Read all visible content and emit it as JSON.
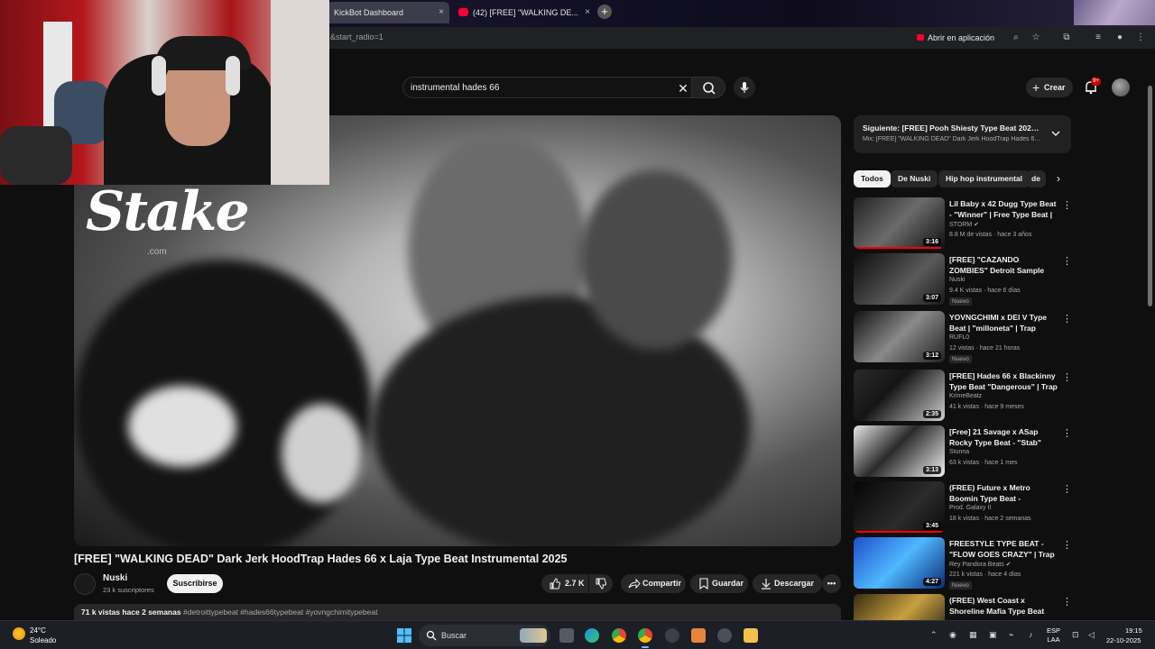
{
  "browser": {
    "tabs": [
      {
        "label": "KickBot Dashboard",
        "close": "×"
      },
      {
        "label": "(42) [FREE] \"WALKING DE...",
        "close": "×"
      }
    ],
    "new_tab": "+",
    "url": "&start_radio=1",
    "open_app_label": "Abrir en aplicación"
  },
  "youtube": {
    "search_value": "instrumental hades 66",
    "search_clear": "✕",
    "create_label": "Crear",
    "notification_badge": "9+"
  },
  "player": {
    "watermark": "Stake",
    "watermark_sub": ".com"
  },
  "video": {
    "title": "[FREE] \"WALKING DEAD\" Dark Jerk HoodTrap Hades 66 x Laja Type Beat Instrumental 2025",
    "channel": "Nuski",
    "subscribers": "23 k suscriptores",
    "subscribe_label": "Suscribirse",
    "likes": "2.7 K",
    "share_label": "Compartir",
    "save_label": "Guardar",
    "download_label": "Descargar",
    "more_label": "•••",
    "description_meta": "71 k vistas  hace 2 semanas",
    "description_tags": "#detroittypebeat #hades66typebeat #yovngchimitypebeat"
  },
  "sidebar": {
    "next_title": "Siguiente: [FREE] Pooh Shiesty Type Beat 2022 - Bl...",
    "next_subtitle": "Mix: [FREE] \"WALKING DEAD\" Dark Jerk HoodTrap Hades 66 ...",
    "chips": [
      "Todos",
      "De Nuski",
      "Hip hop instrumental",
      "de"
    ],
    "recommendations": [
      {
        "title": "Lil Baby x 42 Dugg Type Beat - \"Winner\" | Free Type Beat | ...",
        "channel": "STORM ✔",
        "stats": "8.8 M de vistas · hace 3 años",
        "duration": "3:16",
        "badge": "",
        "progress": 0.96
      },
      {
        "title": "[FREE] \"CAZANDO ZOMBIES\" Detroit Sample Dark Type Beat...",
        "channel": "Nuski",
        "stats": "9.4 K vistas · hace 6 días",
        "duration": "3:07",
        "badge": "Nuevo",
        "progress": 0
      },
      {
        "title": "YOVNGCHIMI x DEI V Type Beat | \"milloneta\" | Trap Instrumental",
        "channel": "RUFL0",
        "stats": "12 vistas · hace 21 horas",
        "duration": "3:12",
        "badge": "Nuevo",
        "progress": 0
      },
      {
        "title": "[FREE] Hades 66 x Blackinny Type Beat \"Dangerous\" | Trap ...",
        "channel": "KrimeBeatz",
        "stats": "41 k vistas · hace 9 meses",
        "duration": "2:35",
        "badge": "",
        "progress": 0
      },
      {
        "title": "[Free] 21 Savage x ASap Rocky Type Beat - \"Stab\"",
        "channel": "Stunna",
        "stats": "63 k vistas · hace 1 mes",
        "duration": "3:13",
        "badge": "",
        "progress": 0
      },
      {
        "title": "(FREE) Future x Metro Boomin Type Beat - \"Brazzier\"",
        "channel": "Prod. Galaxy II",
        "stats": "18 k vistas · hace 2 semanas",
        "duration": "3:45",
        "badge": "",
        "progress": 1.0
      },
      {
        "title": "FREESTYLE TYPE BEAT - \"FLOW GOES CRAZY\" | Trap ...",
        "channel": "Rey Pandora Beats ✔",
        "stats": "221 k vistas · hace 4 días",
        "duration": "4:27",
        "badge": "Nuevo",
        "progress": 0
      },
      {
        "title": "(FREE) West Coast x Shoreline Mafia Type Beat \"GTA\"",
        "channel": "",
        "stats": "",
        "duration": "",
        "badge": "",
        "progress": 0
      }
    ],
    "more_dots": "⋮",
    "chip_arrow": "›"
  },
  "taskbar": {
    "temperature": "24°C",
    "condition": "Soleado",
    "search_label": "Buscar",
    "language_top": "ESP",
    "language_bottom": "LAA",
    "time": "19:15",
    "date": "22-10-2025"
  },
  "colors": {
    "youtube_red": "#ff0033",
    "background": "#0f0f0f",
    "chip_bg": "#272727"
  }
}
